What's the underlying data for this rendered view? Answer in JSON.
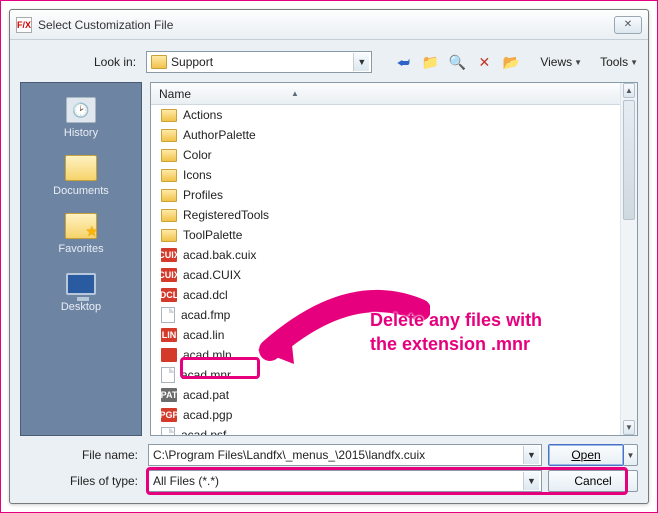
{
  "window": {
    "title": "Select Customization File",
    "icon_label": "F/X"
  },
  "toolbar": {
    "lookin_label": "Look in:",
    "lookin_value": "Support",
    "views_label": "Views",
    "tools_label": "Tools"
  },
  "sidebar": {
    "items": [
      {
        "label": "History"
      },
      {
        "label": "Documents"
      },
      {
        "label": "Favorites"
      },
      {
        "label": "Desktop"
      }
    ]
  },
  "list": {
    "header": "Name",
    "items": [
      {
        "name": "Actions",
        "type": "folder"
      },
      {
        "name": "AuthorPalette",
        "type": "folder"
      },
      {
        "name": "Color",
        "type": "folder"
      },
      {
        "name": "Icons",
        "type": "folder"
      },
      {
        "name": "Profiles",
        "type": "folder"
      },
      {
        "name": "RegisteredTools",
        "type": "folder"
      },
      {
        "name": "ToolPalette",
        "type": "folder"
      },
      {
        "name": "acad.bak.cuix",
        "type": "cuix"
      },
      {
        "name": "acad.CUIX",
        "type": "cuix"
      },
      {
        "name": "acad.dcl",
        "type": "dcl"
      },
      {
        "name": "acad.fmp",
        "type": "doc"
      },
      {
        "name": "acad.lin",
        "type": "lin"
      },
      {
        "name": "acad.mln",
        "type": "mln"
      },
      {
        "name": "acad.mnr",
        "type": "doc"
      },
      {
        "name": "acad.pat",
        "type": "pat"
      },
      {
        "name": "acad.pgp",
        "type": "pgp"
      },
      {
        "name": "acad.psf",
        "type": "doc"
      }
    ]
  },
  "bottom": {
    "filename_label": "File name:",
    "filename_value": "C:\\Program Files\\Landfx\\_menus_\\2015\\landfx.cuix",
    "filetype_label": "Files of type:",
    "filetype_value": "All Files (*.*)",
    "open_label": "Open",
    "cancel_label": "Cancel"
  },
  "annotation": {
    "line1": "Delete any files with",
    "line2": "the extension .mnr"
  }
}
